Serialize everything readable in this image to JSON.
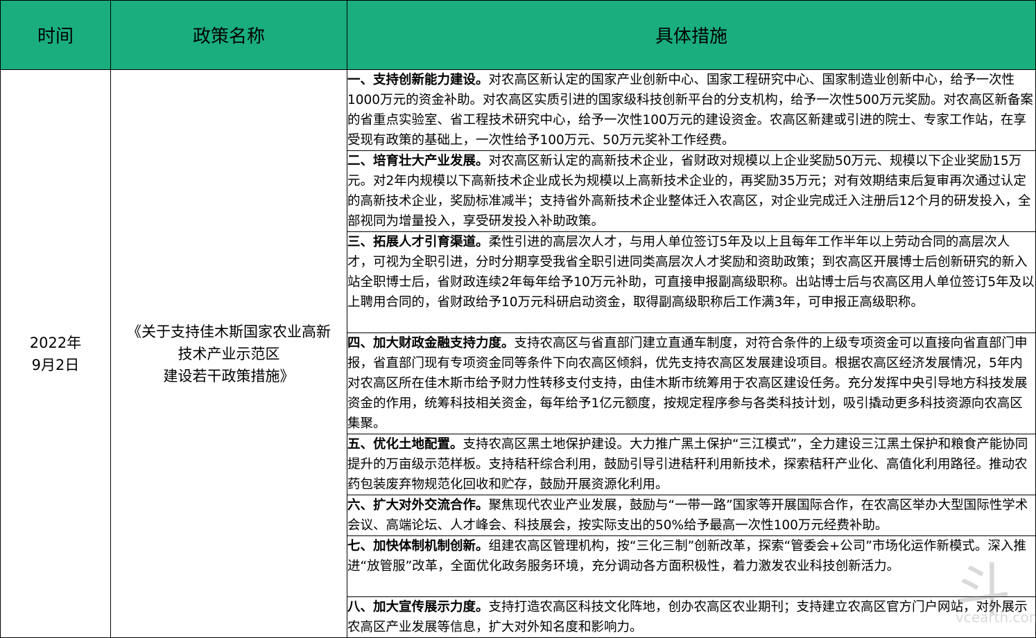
{
  "header": {
    "col_time": "时间",
    "col_name": "政策名称",
    "col_measures": "具体措施"
  },
  "row": {
    "date_line1": "2022年",
    "date_line2": "9月2日",
    "name_line1": "《关于支持佳木斯国家农业高新",
    "name_line2": "技术产业示范区",
    "name_line3": "建设若干政策措施》"
  },
  "measures": [
    {
      "title": "一、支持创新能力建设。",
      "text": "对农高区新认定的国家产业创新中心、国家工程研究中心、国家制造业创新中心，给予一次性1000万元的资金补助。对农高区实质引进的国家级科技创新平台的分支机构，给予一次性500万元奖励。对农高区新备案的省重点实验室、省工程技术研究中心，给予一次性100万元的建设资金。农高区新建或引进的院士、专家工作站，在享受现有政策的基础上，一次性给予100万元、50万元奖补工作经费。"
    },
    {
      "title": "二、培育壮大产业发展。",
      "text": "对农高区新认定的高新技术企业，省财政对规模以上企业奖励50万元、规模以下企业奖励15万元。对2年内规模以下高新技术企业成长为规模以上高新技术企业的，再奖励35万元；对有效期结束后复审再次通过认定的高新技术企业，奖励标准减半；支持省外高新技术企业整体迁入农高区，对企业完成迁入注册后12个月的研发投入，全部视同为增量投入，享受研发投入补助政策。"
    },
    {
      "title": "三、拓展人才引育渠道。",
      "text": "柔性引进的高层次人才，与用人单位签订5年及以上且每年工作半年以上劳动合同的高层次人才，可视为全职引进，分时分期享受我省全职引进同类高层次人才奖励和资助政策；到农高区开展博士后创新研究的新入站全职博士后，省财政连续2年每年给予10万元补助，可直接申报副高级职称。出站博士后与农高区用人单位签订5年及以上聘用合同的，省财政给予10万元科研启动资金，取得副高级职称后工作满3年，可申报正高级职称。"
    },
    {
      "title": "四、加大财政金融支持力度。",
      "text": "支持农高区与省直部门建立直通车制度，对符合条件的上级专项资金可以直接向省直部门申报，省直部门现有专项资金同等条件下向农高区倾斜，优先支持农高区发展建设项目。根据农高区经济发展情况，5年内对农高区所在佳木斯市给予财力性转移支付支持，由佳木斯市统筹用于农高区建设任务。充分发挥中央引导地方科技发展资金的作用，统筹科技相关资金，每年给予1亿元额度，按规定程序参与各类科技计划，吸引撬动更多科技资源向农高区集聚。"
    },
    {
      "title": "五、优化土地配置。",
      "text": "支持农高区黑土地保护建设。大力推广黑土保护“三江模式”，全力建设三江黑土保护和粮食产能协同提升的万亩级示范样板。支持秸秆综合利用，鼓励引导引进秸秆利用新技术，探索秸秆产业化、高值化利用路径。推动农药包装废弃物规范化回收和贮存，鼓励开展资源化利用。"
    },
    {
      "title": "六、扩大对外交流合作。",
      "text": "聚焦现代农业产业发展，鼓励与“一带一路”国家等开展国际合作，在农高区举办大型国际性学术会议、高端论坛、人才峰会、科技展会，按实际支出的50%给予最高一次性100万元经费补助。"
    },
    {
      "title": "七、加快体制机制创新。",
      "text": "组建农高区管理机构，按“三化三制”创新改革，探索“管委会+公司”市场化运作新模式。深入推进“放管服”改革，全面优化政务服务环境，充分调动各方面积极性，着力激发农业科技创新活力。"
    },
    {
      "title": "八、加大宣传展示力度。",
      "text": "支持打造农高区科技文化阵地，创办农高区农业期刊；支持建立农高区官方门户网站，对外展示农高区产业发展等信息，扩大对外知名度和影响力。"
    }
  ],
  "watermark": {
    "text": "vcearth.com"
  }
}
